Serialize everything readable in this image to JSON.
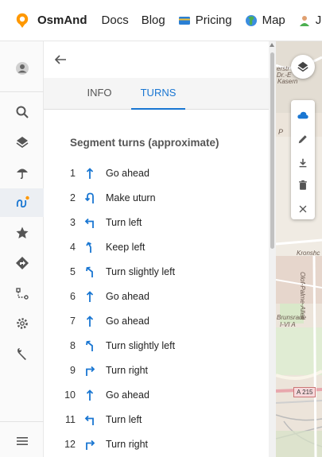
{
  "nav": {
    "brand": "OsmAnd",
    "items": [
      {
        "label": "Docs",
        "icon": null
      },
      {
        "label": "Blog",
        "icon": null
      },
      {
        "label": "Pricing",
        "icon": "credit-card-icon"
      },
      {
        "label": "Map",
        "icon": "globe-icon"
      },
      {
        "label": "Jo",
        "icon": "person-icon"
      }
    ]
  },
  "rail": {
    "items": [
      "avatar",
      "search-icon",
      "layers-icon",
      "weather-icon",
      "tracks-icon",
      "favorites-icon",
      "navigation-icon",
      "route-icon",
      "settings-icon",
      "tools-icon",
      "menu-icon"
    ]
  },
  "panel": {
    "tabs": [
      {
        "label": "INFO",
        "active": false
      },
      {
        "label": "TURNS",
        "active": true
      }
    ],
    "section_title": "Segment turns (approximate)",
    "turns": [
      {
        "num": "1",
        "type": "straight",
        "text": "Go ahead"
      },
      {
        "num": "2",
        "type": "uturn",
        "text": "Make uturn"
      },
      {
        "num": "3",
        "type": "left",
        "text": "Turn left"
      },
      {
        "num": "4",
        "type": "keep-left",
        "text": "Keep left"
      },
      {
        "num": "5",
        "type": "slight-left",
        "text": "Turn slightly left"
      },
      {
        "num": "6",
        "type": "straight",
        "text": "Go ahead"
      },
      {
        "num": "7",
        "type": "straight",
        "text": "Go ahead"
      },
      {
        "num": "8",
        "type": "slight-left",
        "text": "Turn slightly left"
      },
      {
        "num": "9",
        "type": "right",
        "text": "Turn right"
      },
      {
        "num": "10",
        "type": "straight",
        "text": "Go ahead"
      },
      {
        "num": "11",
        "type": "left",
        "text": "Turn left"
      },
      {
        "num": "12",
        "type": "right",
        "text": "Turn right"
      }
    ]
  },
  "map": {
    "labels": [
      "erstr",
      "Dr.-E",
      "Kasern",
      "P",
      "Kronshc",
      "Olof-Palme-Allee",
      "Brunsrade",
      "I-VI A"
    ],
    "road_shield": "A 215"
  },
  "colors": {
    "accent": "#1976d2",
    "brand_orange": "#ff9800"
  }
}
